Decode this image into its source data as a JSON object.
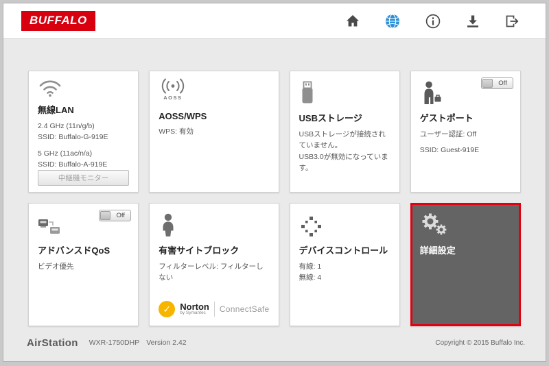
{
  "header": {
    "logo": "BUFFALO"
  },
  "nav_icons": {
    "home-icon": "house",
    "globe-icon": "blue globe (active)",
    "info-icon": "circled i",
    "download-icon": "down arrow into tray",
    "logout-icon": "door with right arrow"
  },
  "cards": {
    "wireless": {
      "title": "無線LAN",
      "band1": "2.4 GHz (11n/g/b)",
      "ssid1": "SSID: Buffalo-G-919E",
      "band2": "5 GHz (11ac/n/a)",
      "ssid2": "SSID: Buffalo-A-919E",
      "button": "中継機モニター",
      "icon": "wifi-arcs"
    },
    "aoss": {
      "title": "AOSS/WPS",
      "line1": "WPS: 有効",
      "icon_label": "AOSS",
      "icon": "signal-dot-arcs"
    },
    "usb": {
      "title": "USBストレージ",
      "line1": "USBストレージが接続されていません。",
      "line2": "USB3.0が無効になっています。",
      "icon": "usb-stick"
    },
    "guest": {
      "title": "ゲストポート",
      "toggle": "Off",
      "line1": "ユーザー認証: Off",
      "line2": "SSID: Guest-919E",
      "icon": "person-with-briefcase"
    },
    "qos": {
      "title": "アドバンスドQoS",
      "toggle": "Off",
      "line1": "ビデオ優先",
      "icon": "stacked-devices"
    },
    "filter": {
      "title": "有害サイトブロック",
      "line1": "フィルターレベル: フィルターしない",
      "norton_check": "✓",
      "norton_name": "Norton",
      "norton_sub": "by Symantec",
      "norton_product": "ConnectSafe",
      "icon": "child-figure"
    },
    "device": {
      "title": "デバイスコントロール",
      "line1": "有線: 1",
      "line2": "無線: 4",
      "icon": "dot-grid"
    },
    "advanced": {
      "title": "詳細設定",
      "icon": "two-gears",
      "highlighted": true
    }
  },
  "footer": {
    "brand": "AirStation",
    "model": "WXR-1750DHP",
    "version": "Version 2.42",
    "copyright": "Copyright © 2015 Buffalo Inc."
  },
  "colors": {
    "brand_red": "#d8000f",
    "highlight_border": "#e3000f",
    "globe_blue": "#2a8fd8",
    "norton_yellow": "#f7b500",
    "advanced_card_bg": "#646464"
  }
}
